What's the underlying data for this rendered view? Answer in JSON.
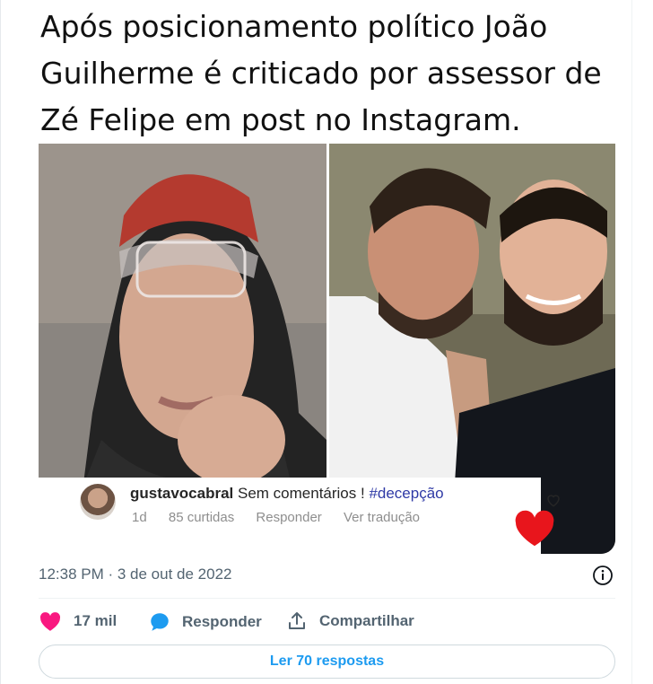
{
  "media": {
    "headline": "Após posicionamento político João Guilherme é criticado por assessor de Zé Felipe em post no Instagram."
  },
  "comment": {
    "username": "gustavocabral",
    "text": " Sem comentários ! ",
    "hashtag": "#decepção",
    "time": "1d",
    "likes": "85 curtidas",
    "reply": "Responder",
    "translate": "Ver tradução"
  },
  "tweet": {
    "timestamp": "12:38 PM · 3 de out de 2022",
    "like_count": "17 mil",
    "reply_label": "Responder",
    "share_label": "Compartilhar",
    "read_replies": "Ler 70 respostas"
  },
  "colors": {
    "like": "#f91880",
    "reply": "#1d9bf0",
    "link": "#1d9bf0",
    "meta": "#536471"
  },
  "icons": [
    "info-icon",
    "heart-icon",
    "speech-bubble-icon",
    "share-icon"
  ]
}
